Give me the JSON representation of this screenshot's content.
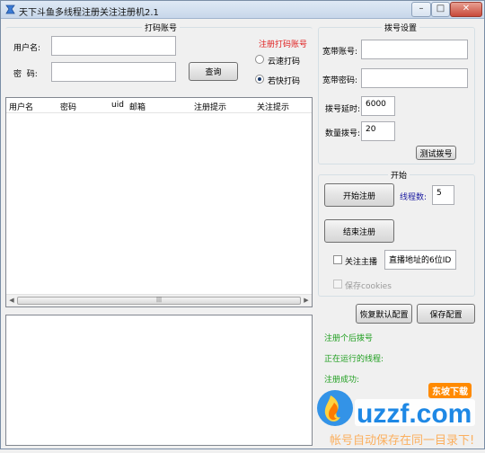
{
  "window": {
    "title": "天下斗鱼多线程注册关注注册机2.1",
    "controls": {
      "minimize": "–",
      "maximize": "□",
      "close": "✕"
    }
  },
  "dama_group": {
    "title": "打码账号",
    "username_label": "用户名:",
    "username_value": "",
    "password_label": "密  码:",
    "password_value": "",
    "query_button": "查询",
    "register_link": "注册打码账号",
    "options": [
      {
        "label": "云速打码",
        "selected": false
      },
      {
        "label": "若快打码",
        "selected": true
      }
    ]
  },
  "account_table": {
    "columns": [
      "用户名",
      "密码",
      "uid",
      "邮箱",
      "注册提示",
      "关注提示"
    ],
    "rows": []
  },
  "dial_group": {
    "title": "拨号设置",
    "broadband_account_label": "宽带账号:",
    "broadband_account_value": "",
    "broadband_password_label": "宽带密码:",
    "broadband_password_value": "",
    "dial_timeout_label": "拨号延时:",
    "dial_timeout_value": "6000",
    "dial_count_label": "数量拨号:",
    "dial_count_value": "20",
    "test_dial_button": "测试拨号"
  },
  "start_group": {
    "title": "开始",
    "start_register_button": "开始注册",
    "thread_count_label": "线程数:",
    "thread_count_value": "5",
    "stop_register_button": "结束注册",
    "follow_anchor_label": "关注主播",
    "follow_anchor_checked": false,
    "room_id_value": "直播地址的6位ID",
    "save_cookies_label": "保存cookies",
    "save_cookies_checked": false
  },
  "bottom_buttons": {
    "restore_default": "恢复默认配置",
    "save_config": "保存配置"
  },
  "status_lines": [
    "注册个后拨号",
    "正在运行的线程:",
    "注册成功:"
  ],
  "watermark": {
    "brand": "uzzf.com",
    "badge": "东坡下载",
    "overlay_text": "帐号自动保存在同一目录下!"
  },
  "colors": {
    "accent_red": "#e02020",
    "thread_label_blue": "#1a1aa0",
    "status_green": "#1e9e1e",
    "watermark_orange": "#ff8a00",
    "watermark_blue": "#1e88e5"
  }
}
